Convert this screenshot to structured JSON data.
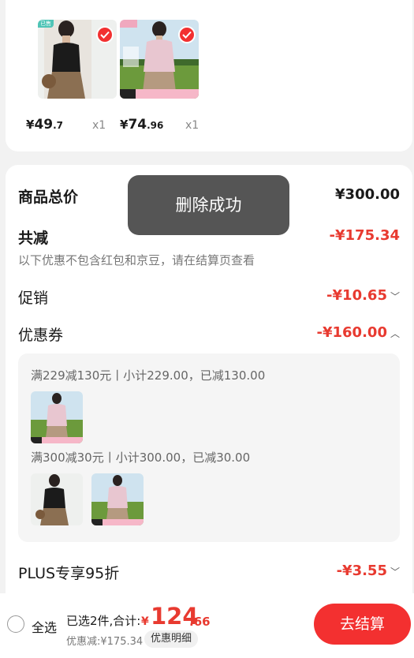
{
  "products": [
    {
      "tag": "已售",
      "currency": "¥",
      "price_int": "49",
      "price_dec": ".7",
      "qty": "x1"
    },
    {
      "tag": "新品上市",
      "currency": "¥",
      "price_int": "74",
      "price_dec": ".96",
      "qty": "x1"
    }
  ],
  "summary": {
    "total_label": "商品总价",
    "total_value": "¥300.00",
    "reduce_label": "共减",
    "reduce_value": "-¥175.34",
    "note": "以下优惠不包含红包和京豆，请在结算页查看",
    "promo_label": "促销",
    "promo_value": "-¥10.65",
    "coupon_label": "优惠券",
    "coupon_value": "-¥160.00",
    "coupon_lines": [
      "满229减130元丨小计229.00，已减130.00",
      "满300减30元丨小计300.00，已减30.00"
    ],
    "plus_label": "PLUS专享95折",
    "plus_value": "-¥3.55"
  },
  "toast": "删除成功",
  "bottom": {
    "select_all": "全选",
    "selected_info": "已选2件,合计:",
    "currency": "¥",
    "total_int": "124",
    "total_dec": ".66",
    "discount_info": "优惠减:¥175.34",
    "detail_button": "优惠明细",
    "checkout_button": "去结算"
  },
  "colors": {
    "accent": "#f33030",
    "price_red": "#e83a30",
    "toast_bg": "#555555"
  }
}
